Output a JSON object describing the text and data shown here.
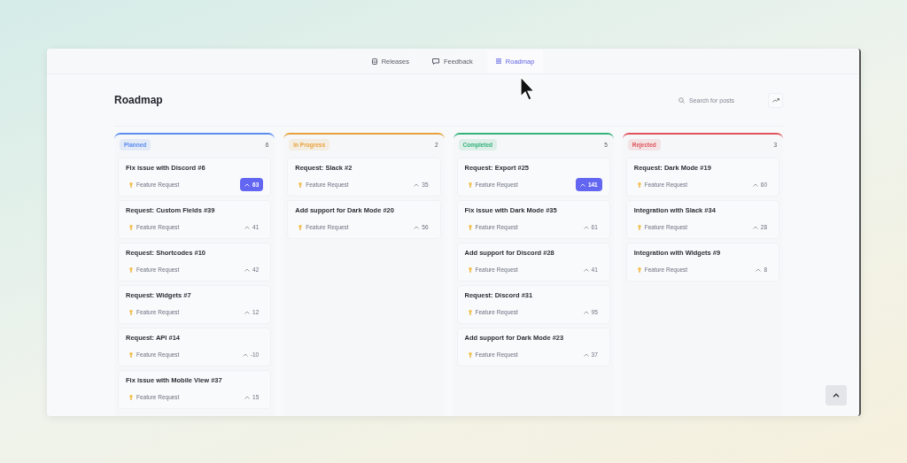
{
  "nav": {
    "tabs": [
      {
        "label": "Releases",
        "kind": "doc",
        "selected": false
      },
      {
        "label": "Feedback",
        "kind": "chat",
        "selected": false
      },
      {
        "label": "Roadmap",
        "kind": "list",
        "selected": true
      }
    ]
  },
  "page": {
    "title": "Roadmap",
    "search": {
      "placeholder": "Search for posts"
    }
  },
  "columns": [
    {
      "name": "Planned",
      "color": "#5b8def",
      "count": "6",
      "cards": [
        {
          "title": "Fix issue with Discord #6",
          "category": "Feature Request",
          "votes": "63",
          "voted": true
        },
        {
          "title": "Request: Custom Fields #39",
          "category": "Feature Request",
          "votes": "41",
          "voted": false
        },
        {
          "title": "Request: Shortcodes #10",
          "category": "Feature Request",
          "votes": "42",
          "voted": false
        },
        {
          "title": "Request: Widgets #7",
          "category": "Feature Request",
          "votes": "12",
          "voted": false
        },
        {
          "title": "Request: API #14",
          "category": "Feature Request",
          "votes": "-10",
          "voted": false
        },
        {
          "title": "Fix issue with Mobile View #37",
          "category": "Feature Request",
          "votes": "15",
          "voted": false
        }
      ]
    },
    {
      "name": "In Progress",
      "color": "#e9a23b",
      "count": "2",
      "cards": [
        {
          "title": "Request: Slack #2",
          "category": "Feature Request",
          "votes": "35",
          "voted": false
        },
        {
          "title": "Add support for Dark Mode #20",
          "category": "Feature Request",
          "votes": "56",
          "voted": false
        }
      ]
    },
    {
      "name": "Completed",
      "color": "#34b27b",
      "count": "5",
      "cards": [
        {
          "title": "Request: Export #25",
          "category": "Feature Request",
          "votes": "141",
          "voted": true
        },
        {
          "title": "Fix issue with Dark Mode #35",
          "category": "Feature Request",
          "votes": "61",
          "voted": false
        },
        {
          "title": "Add support for Discord #28",
          "category": "Feature Request",
          "votes": "41",
          "voted": false
        },
        {
          "title": "Request: Discord #31",
          "category": "Feature Request",
          "votes": "95",
          "voted": false
        },
        {
          "title": "Add support for Dark Mode #23",
          "category": "Feature Request",
          "votes": "37",
          "voted": false
        }
      ]
    },
    {
      "name": "Rejected",
      "color": "#e0555b",
      "count": "3",
      "cards": [
        {
          "title": "Request: Dark Mode #19",
          "category": "Feature Request",
          "votes": "60",
          "voted": false
        },
        {
          "title": "Integration with Slack #34",
          "category": "Feature Request",
          "votes": "28",
          "voted": false
        },
        {
          "title": "Integration with Widgets #9",
          "category": "Feature Request",
          "votes": "8",
          "voted": false
        }
      ]
    }
  ]
}
